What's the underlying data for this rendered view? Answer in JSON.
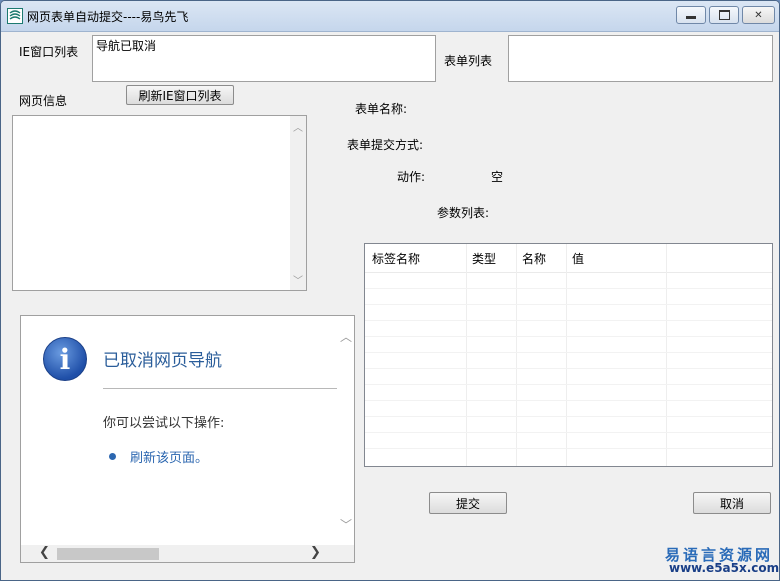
{
  "window": {
    "title": "网页表单自动提交----易鸟先飞",
    "controls": {
      "minimize": "",
      "maximize": "",
      "close": "✕"
    }
  },
  "labels": {
    "ie_window_list": "IE窗口列表",
    "form_list": "表单列表",
    "page_info": "网页信息",
    "form_name": "表单名称:",
    "form_submit_method": "表单提交方式:",
    "action": "动作:",
    "action_value": "空",
    "param_list": "参数列表:"
  },
  "ie_window_field": {
    "value": "导航已取消"
  },
  "buttons": {
    "refresh_ie": "刷新IE窗口列表",
    "submit": "提交",
    "cancel": "取消"
  },
  "param_table": {
    "columns": [
      "标签名称",
      "类型",
      "名称",
      "值"
    ],
    "rows": []
  },
  "embedded_browser": {
    "title": "已取消网页导航",
    "subtitle": "你可以尝试以下操作:",
    "link": "刷新该页面。"
  },
  "watermark": {
    "line1": "易语言资源网",
    "line2": "www.e5a5x.com"
  }
}
